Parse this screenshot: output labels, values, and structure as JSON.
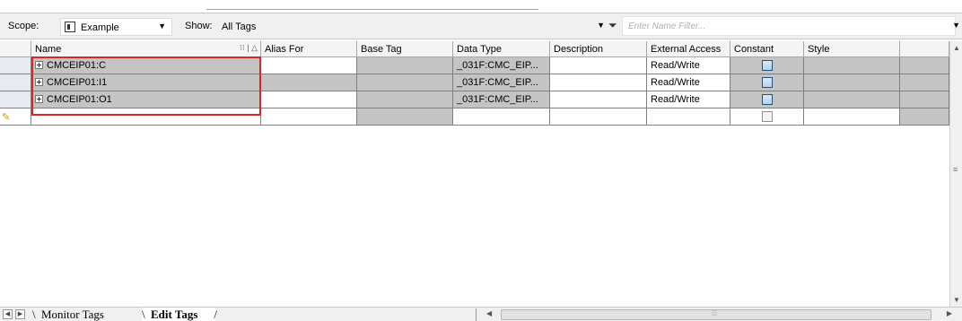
{
  "toolbar": {
    "scope_label": "Scope:",
    "scope_value": "Example",
    "show_label": "Show:",
    "show_value": "All Tags",
    "filter_placeholder": "Enter Name Filter..."
  },
  "columns": {
    "name": "Name",
    "alias_for": "Alias For",
    "base_tag": "Base Tag",
    "data_type": "Data Type",
    "description": "Description",
    "external_access": "External Access",
    "constant": "Constant",
    "style": "Style"
  },
  "rows": [
    {
      "name": "CMCEIP01:C",
      "alias_for": "",
      "base_tag": "",
      "data_type": "_031F:CMC_EIP...",
      "description": "",
      "external_access": "Read/Write",
      "constant": false,
      "style": ""
    },
    {
      "name": "CMCEIP01:I1",
      "alias_for": "",
      "base_tag": "",
      "data_type": "_031F:CMC_EIP...",
      "description": "",
      "external_access": "Read/Write",
      "constant": false,
      "style": ""
    },
    {
      "name": "CMCEIP01:O1",
      "alias_for": "",
      "base_tag": "",
      "data_type": "_031F:CMC_EIP...",
      "description": "",
      "external_access": "Read/Write",
      "constant": false,
      "style": ""
    }
  ],
  "tabs": {
    "monitor": "Monitor Tags",
    "edit": "Edit Tags"
  },
  "colors": {
    "highlight": "#d9262a",
    "readonly_cell": "#c4c4c4"
  },
  "icons": [
    "scope-icon",
    "dropdown-arrow-icon",
    "filter-icon",
    "expand-plus-icon",
    "pencil-icon",
    "checkbox-icon",
    "scroll-arrow-icon"
  ]
}
